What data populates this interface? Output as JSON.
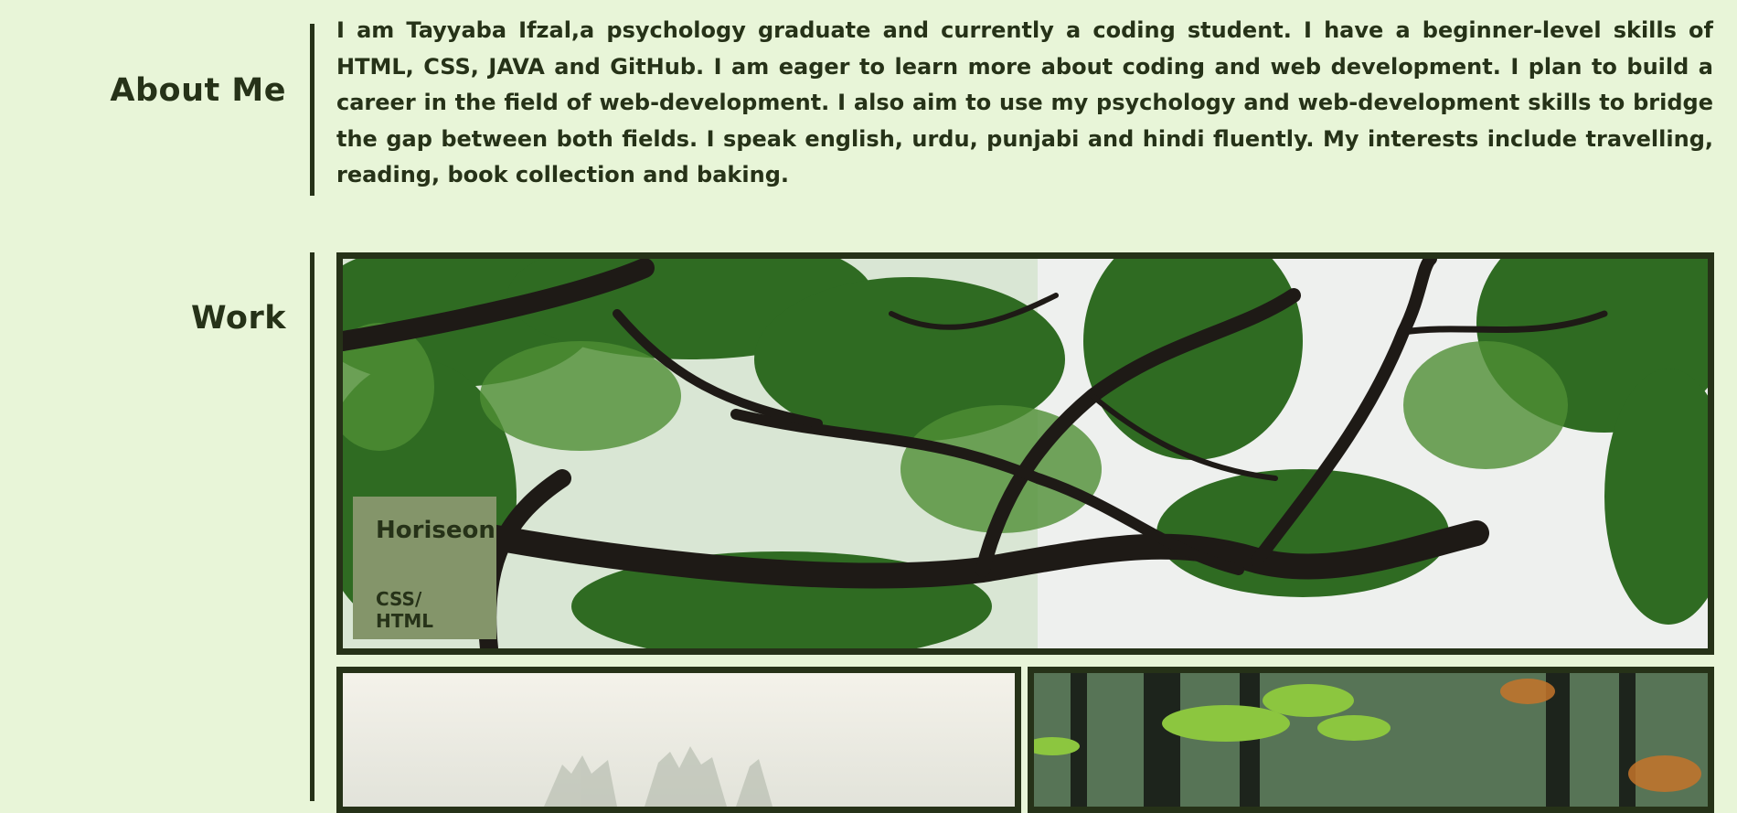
{
  "about": {
    "title": "About Me",
    "text": "I am Tayyaba Ifzal,a psychology graduate and currently a coding student. I have a beginner-level skills of HTML, CSS, JAVA and GitHub. I am eager to learn more about coding and web development. I plan to build a career in the field of web-development. I also aim to use my psychology and web-development skills to bridge the gap between both fields. I speak english, urdu, punjabi and hindi fluently. My interests include travelling, reading, book collection and baking."
  },
  "work": {
    "title": "Work",
    "projects": [
      {
        "name": "Horiseon",
        "tech": "CSS/ HTML"
      }
    ]
  },
  "colors": {
    "background": "#e8f5d8",
    "accent": "#263218",
    "label_background": "#84956a"
  }
}
